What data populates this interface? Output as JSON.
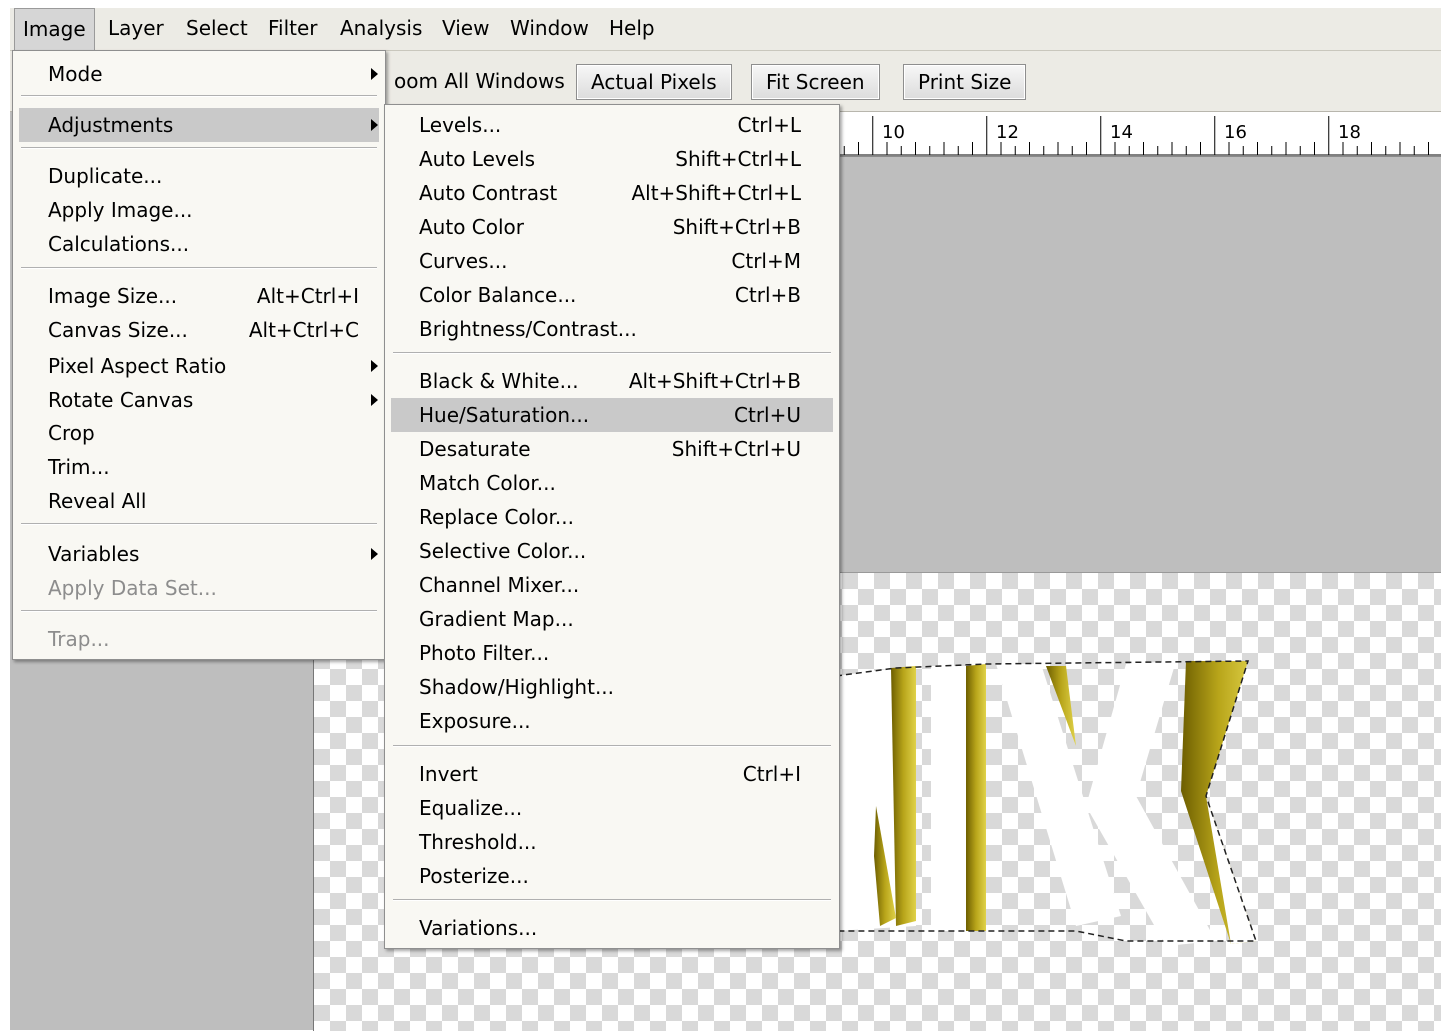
{
  "menubar": {
    "items": [
      {
        "label": "Image"
      },
      {
        "label": "Layer"
      },
      {
        "label": "Select"
      },
      {
        "label": "Filter"
      },
      {
        "label": "Analysis"
      },
      {
        "label": "View"
      },
      {
        "label": "Window"
      },
      {
        "label": "Help"
      }
    ]
  },
  "options_bar": {
    "zoom_all_partial": "oom All Windows",
    "actual_pixels": "Actual Pixels",
    "fit_screen": "Fit Screen",
    "print_size": "Print Size"
  },
  "ruler": {
    "labels": [
      "10",
      "12",
      "14",
      "16",
      "18"
    ]
  },
  "image_menu": {
    "items": [
      {
        "label": "Mode",
        "submenu": true
      },
      {
        "label": "Adjustments",
        "submenu": true,
        "highlighted": true
      },
      {
        "label": "Duplicate..."
      },
      {
        "label": "Apply Image..."
      },
      {
        "label": "Calculations..."
      },
      {
        "label": "Image Size...",
        "shortcut": "Alt+Ctrl+I"
      },
      {
        "label": "Canvas Size...",
        "shortcut": "Alt+Ctrl+C"
      },
      {
        "label": "Pixel Aspect Ratio",
        "submenu": true
      },
      {
        "label": "Rotate Canvas",
        "submenu": true
      },
      {
        "label": "Crop"
      },
      {
        "label": "Trim..."
      },
      {
        "label": "Reveal All"
      },
      {
        "label": "Variables",
        "submenu": true
      },
      {
        "label": "Apply Data Set...",
        "disabled": true
      },
      {
        "label": "Trap...",
        "disabled": true
      }
    ]
  },
  "adjustments_menu": {
    "items": [
      {
        "label": "Levels...",
        "shortcut": "Ctrl+L"
      },
      {
        "label": "Auto Levels",
        "shortcut": "Shift+Ctrl+L"
      },
      {
        "label": "Auto Contrast",
        "shortcut": "Alt+Shift+Ctrl+L"
      },
      {
        "label": "Auto Color",
        "shortcut": "Shift+Ctrl+B"
      },
      {
        "label": "Curves...",
        "shortcut": "Ctrl+M"
      },
      {
        "label": "Color Balance...",
        "shortcut": "Ctrl+B"
      },
      {
        "label": "Brightness/Contrast..."
      },
      {
        "label": "Black & White...",
        "shortcut": "Alt+Shift+Ctrl+B"
      },
      {
        "label": "Hue/Saturation...",
        "shortcut": "Ctrl+U",
        "highlighted": true
      },
      {
        "label": "Desaturate",
        "shortcut": "Shift+Ctrl+U"
      },
      {
        "label": "Match Color..."
      },
      {
        "label": "Replace Color..."
      },
      {
        "label": "Selective Color..."
      },
      {
        "label": "Channel Mixer..."
      },
      {
        "label": "Gradient Map..."
      },
      {
        "label": "Photo Filter..."
      },
      {
        "label": "Shadow/Highlight..."
      },
      {
        "label": "Exposure..."
      },
      {
        "label": "Invert",
        "shortcut": "Ctrl+I"
      },
      {
        "label": "Equalize..."
      },
      {
        "label": "Threshold..."
      },
      {
        "label": "Posterize..."
      },
      {
        "label": "Variations..."
      }
    ]
  },
  "colors": {
    "menu_bg": "#f9f8f3",
    "highlight": "#c9c9c9",
    "workspace": "#bebebe",
    "text_gold": "#b5a315"
  }
}
